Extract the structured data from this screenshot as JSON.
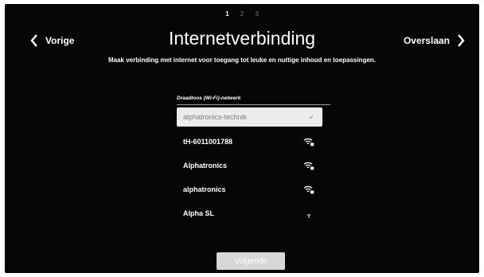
{
  "steps": [
    "1",
    "2",
    "3"
  ],
  "nav": {
    "previous": "Vorige",
    "skip": "Overslaan"
  },
  "title": "Internetverbinding",
  "subtitle": "Maak verbinding met internet voor toegang tot leuke en nuttige inhoud en toepassingen.",
  "section_label": "Draadloos (Wi-Fi)-netwerk",
  "networks": [
    {
      "name": "alphatronics-technik",
      "status": "✓",
      "icon": "check-icon"
    },
    {
      "name": "tH-6011001788",
      "icon": "wifi-locked-icon"
    },
    {
      "name": "Alphatronics",
      "icon": "wifi-locked-icon"
    },
    {
      "name": "alphatronics",
      "icon": "wifi-locked-icon"
    },
    {
      "name": "Alpha SL",
      "icon": "wifi-weak-icon"
    }
  ],
  "next_button": "Volgende",
  "colors": {
    "background": "#060606",
    "selected_row": "#ececec",
    "button": "#d7d7d7"
  }
}
